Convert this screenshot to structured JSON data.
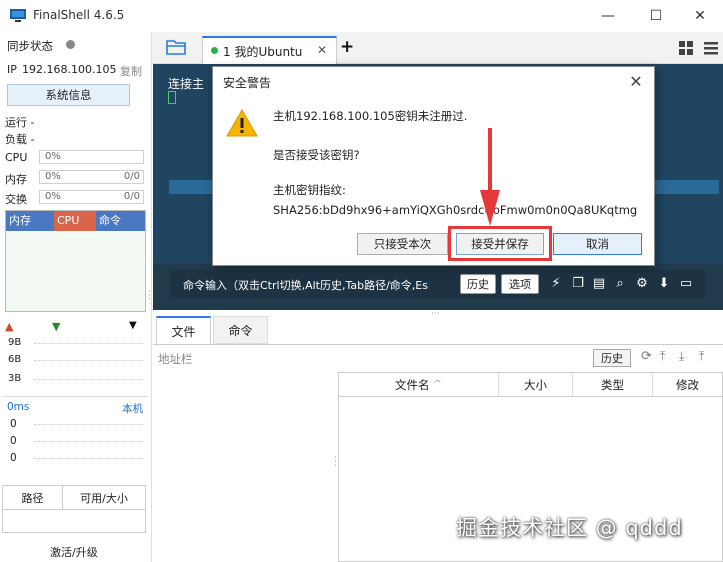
{
  "window": {
    "title": "FinalShell 4.6.5",
    "controls": [
      "—",
      "☐",
      "✕"
    ]
  },
  "sidebar": {
    "sync_label": "同步状态",
    "ip_label": "IP",
    "ip_value": "192.168.100.105",
    "copy_label": "复制",
    "sysinfo_button": "系统信息",
    "running_label": "运行 -",
    "load_label": "负载 -",
    "cpu_label": "CPU",
    "cpu_value": "0%",
    "mem_label": "内存",
    "mem_value": "0%",
    "mem_ratio": "0/0",
    "swap_label": "交换",
    "swap_value": "0%",
    "swap_ratio": "0/0",
    "proc_headers": [
      "内存",
      "CPU",
      "命令"
    ],
    "net_values": [
      "9B",
      "6B",
      "3B"
    ],
    "ping_label": "0ms",
    "ping_host": "本机",
    "ping_values": [
      "0",
      "0",
      "0"
    ],
    "disk_headers": [
      "路径",
      "可用/大小"
    ],
    "activate_label": "激活/升级"
  },
  "tabs": {
    "active_label": "1 我的Ubuntu",
    "add_label": "+"
  },
  "terminal": {
    "connecting_text": "连接主",
    "cmd_input_label": "命令输入（双击Ctrl切换,Alt历史,Tab路径/命令,Es",
    "history_button": "历史",
    "options_button": "选项"
  },
  "lower": {
    "tab_files": "文件",
    "tab_commands": "命令",
    "address_label": "地址栏",
    "history_button": "历史",
    "columns": [
      "文件名",
      "大小",
      "类型",
      "修改"
    ]
  },
  "dialog": {
    "title": "安全警告",
    "line1": "主机192.168.100.105密钥未注册过.",
    "line2": "是否接受该密钥?",
    "line3": "主机密钥指纹:",
    "line4": "SHA256:bDd9hx96+amYiQXGh0srdcUoFmw0m0n0Qa8UKqtmg",
    "btn_once": "只接受本次",
    "btn_save": "接受并保存",
    "btn_cancel": "取消"
  },
  "watermark": "掘金技术社区 @ qddd",
  "colors": {
    "terminal_bg": "#1f4560",
    "highlight_red": "#e5383b",
    "accent_blue": "#2a7be4",
    "proc_mem": "#4a78c2",
    "proc_cpu": "#d9664a",
    "proc_cmd": "#4a78c2"
  }
}
